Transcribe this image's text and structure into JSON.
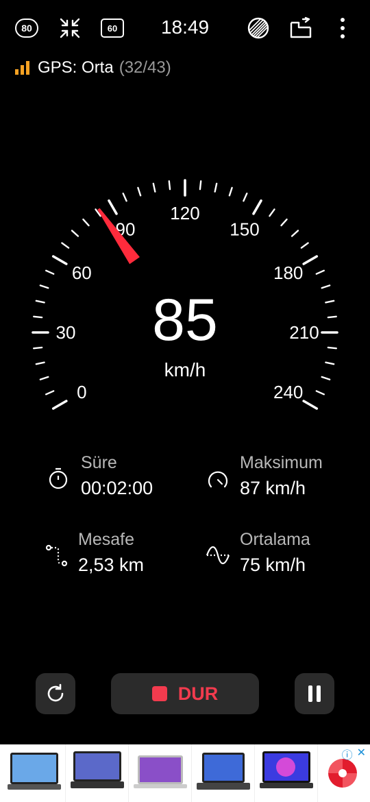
{
  "topbar": {
    "speed_limit_badge": "80",
    "hud_badge": "60",
    "time": "18:49"
  },
  "gps": {
    "label": "GPS: Orta",
    "count": "(32/43)",
    "signal_color": "#f6a223"
  },
  "gauge": {
    "tick_labels": [
      "0",
      "30",
      "60",
      "90",
      "120",
      "150",
      "180",
      "210",
      "240"
    ],
    "min": 0,
    "max": 240,
    "needle_value": 85,
    "needle_color": "#ff2b3c"
  },
  "speed": {
    "value": "85",
    "unit": "km/h"
  },
  "stats": {
    "duration": {
      "label": "Süre",
      "value": "00:02:00"
    },
    "max": {
      "label": "Maksimum",
      "value": "87 km/h"
    },
    "distance": {
      "label": "Mesafe",
      "value": "2,53 km"
    },
    "average": {
      "label": "Ortalama",
      "value": "75 km/h"
    }
  },
  "controls": {
    "stop_label": "DUR",
    "accent": "#f23b4e"
  },
  "ad": {
    "items": [
      "laptop-1",
      "laptop-2",
      "laptop-3",
      "laptop-4",
      "laptop-5"
    ],
    "info_icon": "ⓘ",
    "close_icon": "✕"
  }
}
